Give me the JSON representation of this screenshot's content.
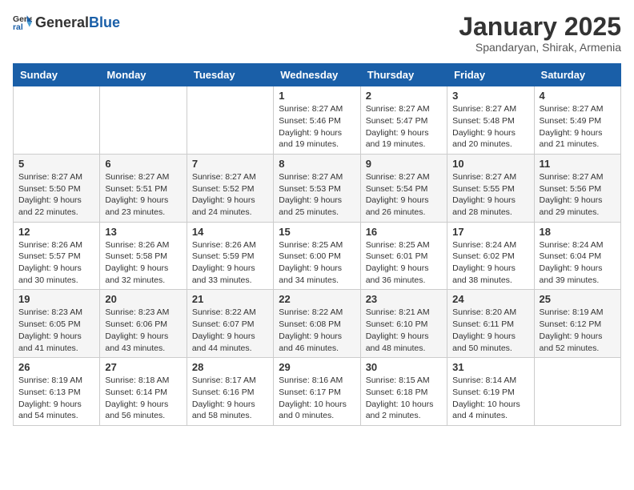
{
  "logo": {
    "general": "General",
    "blue": "Blue"
  },
  "header": {
    "month": "January 2025",
    "location": "Spandaryan, Shirak, Armenia"
  },
  "weekdays": [
    "Sunday",
    "Monday",
    "Tuesday",
    "Wednesday",
    "Thursday",
    "Friday",
    "Saturday"
  ],
  "weeks": [
    [
      {
        "day": "",
        "sunrise": "",
        "sunset": "",
        "daylight": ""
      },
      {
        "day": "",
        "sunrise": "",
        "sunset": "",
        "daylight": ""
      },
      {
        "day": "",
        "sunrise": "",
        "sunset": "",
        "daylight": ""
      },
      {
        "day": "1",
        "sunrise": "Sunrise: 8:27 AM",
        "sunset": "Sunset: 5:46 PM",
        "daylight": "Daylight: 9 hours and 19 minutes."
      },
      {
        "day": "2",
        "sunrise": "Sunrise: 8:27 AM",
        "sunset": "Sunset: 5:47 PM",
        "daylight": "Daylight: 9 hours and 19 minutes."
      },
      {
        "day": "3",
        "sunrise": "Sunrise: 8:27 AM",
        "sunset": "Sunset: 5:48 PM",
        "daylight": "Daylight: 9 hours and 20 minutes."
      },
      {
        "day": "4",
        "sunrise": "Sunrise: 8:27 AM",
        "sunset": "Sunset: 5:49 PM",
        "daylight": "Daylight: 9 hours and 21 minutes."
      }
    ],
    [
      {
        "day": "5",
        "sunrise": "Sunrise: 8:27 AM",
        "sunset": "Sunset: 5:50 PM",
        "daylight": "Daylight: 9 hours and 22 minutes."
      },
      {
        "day": "6",
        "sunrise": "Sunrise: 8:27 AM",
        "sunset": "Sunset: 5:51 PM",
        "daylight": "Daylight: 9 hours and 23 minutes."
      },
      {
        "day": "7",
        "sunrise": "Sunrise: 8:27 AM",
        "sunset": "Sunset: 5:52 PM",
        "daylight": "Daylight: 9 hours and 24 minutes."
      },
      {
        "day": "8",
        "sunrise": "Sunrise: 8:27 AM",
        "sunset": "Sunset: 5:53 PM",
        "daylight": "Daylight: 9 hours and 25 minutes."
      },
      {
        "day": "9",
        "sunrise": "Sunrise: 8:27 AM",
        "sunset": "Sunset: 5:54 PM",
        "daylight": "Daylight: 9 hours and 26 minutes."
      },
      {
        "day": "10",
        "sunrise": "Sunrise: 8:27 AM",
        "sunset": "Sunset: 5:55 PM",
        "daylight": "Daylight: 9 hours and 28 minutes."
      },
      {
        "day": "11",
        "sunrise": "Sunrise: 8:27 AM",
        "sunset": "Sunset: 5:56 PM",
        "daylight": "Daylight: 9 hours and 29 minutes."
      }
    ],
    [
      {
        "day": "12",
        "sunrise": "Sunrise: 8:26 AM",
        "sunset": "Sunset: 5:57 PM",
        "daylight": "Daylight: 9 hours and 30 minutes."
      },
      {
        "day": "13",
        "sunrise": "Sunrise: 8:26 AM",
        "sunset": "Sunset: 5:58 PM",
        "daylight": "Daylight: 9 hours and 32 minutes."
      },
      {
        "day": "14",
        "sunrise": "Sunrise: 8:26 AM",
        "sunset": "Sunset: 5:59 PM",
        "daylight": "Daylight: 9 hours and 33 minutes."
      },
      {
        "day": "15",
        "sunrise": "Sunrise: 8:25 AM",
        "sunset": "Sunset: 6:00 PM",
        "daylight": "Daylight: 9 hours and 34 minutes."
      },
      {
        "day": "16",
        "sunrise": "Sunrise: 8:25 AM",
        "sunset": "Sunset: 6:01 PM",
        "daylight": "Daylight: 9 hours and 36 minutes."
      },
      {
        "day": "17",
        "sunrise": "Sunrise: 8:24 AM",
        "sunset": "Sunset: 6:02 PM",
        "daylight": "Daylight: 9 hours and 38 minutes."
      },
      {
        "day": "18",
        "sunrise": "Sunrise: 8:24 AM",
        "sunset": "Sunset: 6:04 PM",
        "daylight": "Daylight: 9 hours and 39 minutes."
      }
    ],
    [
      {
        "day": "19",
        "sunrise": "Sunrise: 8:23 AM",
        "sunset": "Sunset: 6:05 PM",
        "daylight": "Daylight: 9 hours and 41 minutes."
      },
      {
        "day": "20",
        "sunrise": "Sunrise: 8:23 AM",
        "sunset": "Sunset: 6:06 PM",
        "daylight": "Daylight: 9 hours and 43 minutes."
      },
      {
        "day": "21",
        "sunrise": "Sunrise: 8:22 AM",
        "sunset": "Sunset: 6:07 PM",
        "daylight": "Daylight: 9 hours and 44 minutes."
      },
      {
        "day": "22",
        "sunrise": "Sunrise: 8:22 AM",
        "sunset": "Sunset: 6:08 PM",
        "daylight": "Daylight: 9 hours and 46 minutes."
      },
      {
        "day": "23",
        "sunrise": "Sunrise: 8:21 AM",
        "sunset": "Sunset: 6:10 PM",
        "daylight": "Daylight: 9 hours and 48 minutes."
      },
      {
        "day": "24",
        "sunrise": "Sunrise: 8:20 AM",
        "sunset": "Sunset: 6:11 PM",
        "daylight": "Daylight: 9 hours and 50 minutes."
      },
      {
        "day": "25",
        "sunrise": "Sunrise: 8:19 AM",
        "sunset": "Sunset: 6:12 PM",
        "daylight": "Daylight: 9 hours and 52 minutes."
      }
    ],
    [
      {
        "day": "26",
        "sunrise": "Sunrise: 8:19 AM",
        "sunset": "Sunset: 6:13 PM",
        "daylight": "Daylight: 9 hours and 54 minutes."
      },
      {
        "day": "27",
        "sunrise": "Sunrise: 8:18 AM",
        "sunset": "Sunset: 6:14 PM",
        "daylight": "Daylight: 9 hours and 56 minutes."
      },
      {
        "day": "28",
        "sunrise": "Sunrise: 8:17 AM",
        "sunset": "Sunset: 6:16 PM",
        "daylight": "Daylight: 9 hours and 58 minutes."
      },
      {
        "day": "29",
        "sunrise": "Sunrise: 8:16 AM",
        "sunset": "Sunset: 6:17 PM",
        "daylight": "Daylight: 10 hours and 0 minutes."
      },
      {
        "day": "30",
        "sunrise": "Sunrise: 8:15 AM",
        "sunset": "Sunset: 6:18 PM",
        "daylight": "Daylight: 10 hours and 2 minutes."
      },
      {
        "day": "31",
        "sunrise": "Sunrise: 8:14 AM",
        "sunset": "Sunset: 6:19 PM",
        "daylight": "Daylight: 10 hours and 4 minutes."
      },
      {
        "day": "",
        "sunrise": "",
        "sunset": "",
        "daylight": ""
      }
    ]
  ]
}
